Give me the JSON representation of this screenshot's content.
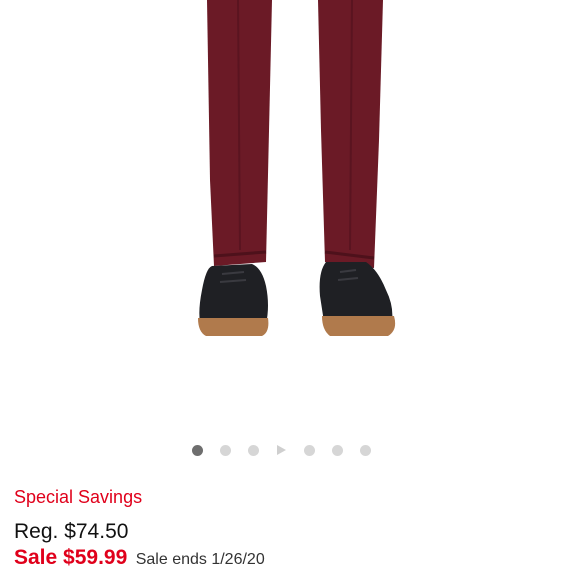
{
  "product": {
    "image_alt": "Burgundy pants with black shoes",
    "colors": {
      "pants": "#6b1a26",
      "shoe_upper": "#1f2024",
      "shoe_sole": "#b07a4c"
    }
  },
  "carousel": {
    "items": [
      {
        "type": "dot",
        "active": true
      },
      {
        "type": "dot",
        "active": false
      },
      {
        "type": "dot",
        "active": false
      },
      {
        "type": "video",
        "active": false
      },
      {
        "type": "dot",
        "active": false
      },
      {
        "type": "dot",
        "active": false
      },
      {
        "type": "dot",
        "active": false
      }
    ]
  },
  "pricing": {
    "promo_label": "Special Savings",
    "regular_price": "Reg. $74.50",
    "sale_price": "Sale $59.99",
    "sale_ends": "Sale ends 1/26/20",
    "accent_color": "#e0001b"
  }
}
